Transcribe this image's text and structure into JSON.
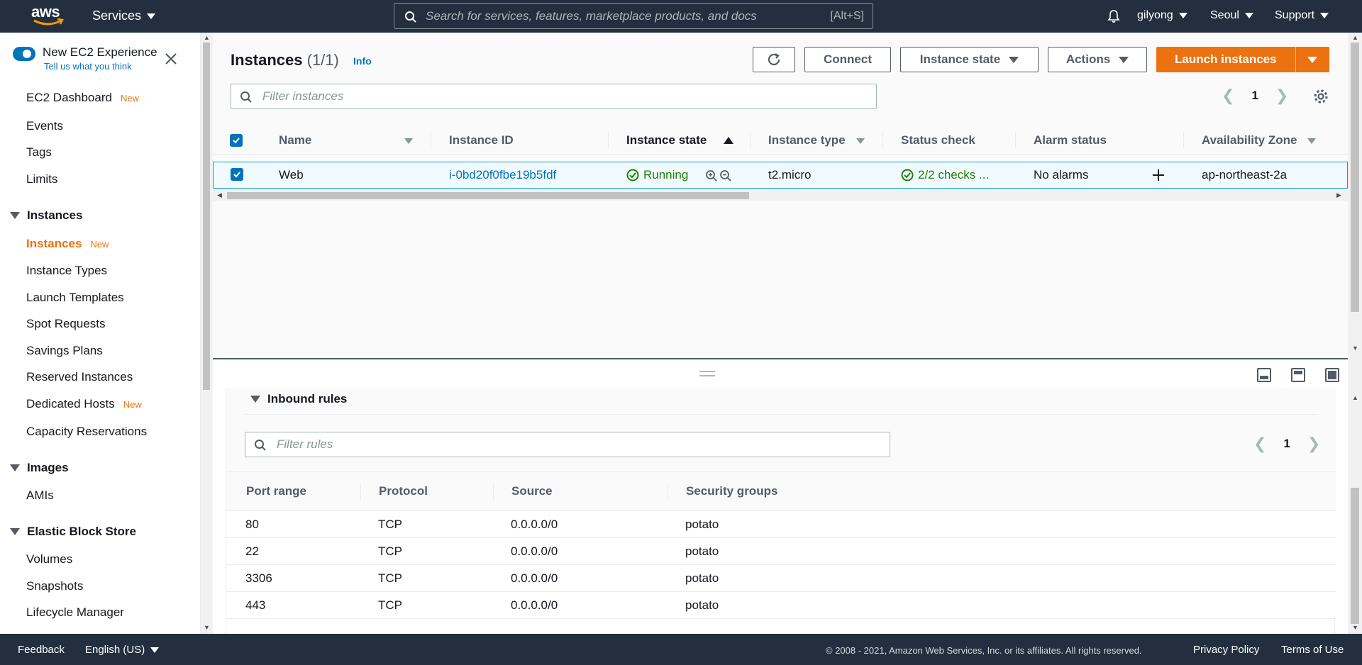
{
  "topnav": {
    "logo": "aws",
    "services": "Services",
    "search_placeholder": "Search for services, features, marketplace products, and docs",
    "search_shortcut": "[Alt+S]",
    "user": "gilyong",
    "region": "Seoul",
    "support": "Support"
  },
  "sidebar": {
    "new_experience": "New EC2 Experience",
    "tell_us": "Tell us what you think",
    "items": [
      {
        "label": "EC2 Dashboard",
        "badge": "New"
      },
      {
        "label": "Events"
      },
      {
        "label": "Tags"
      },
      {
        "label": "Limits"
      }
    ],
    "sections": {
      "instances": {
        "title": "Instances",
        "items": [
          {
            "label": "Instances",
            "badge": "New"
          },
          {
            "label": "Instance Types"
          },
          {
            "label": "Launch Templates"
          },
          {
            "label": "Spot Requests"
          },
          {
            "label": "Savings Plans"
          },
          {
            "label": "Reserved Instances"
          },
          {
            "label": "Dedicated Hosts",
            "badge": "New"
          },
          {
            "label": "Capacity Reservations"
          }
        ]
      },
      "images": {
        "title": "Images",
        "items": [
          {
            "label": "AMIs"
          }
        ]
      },
      "ebs": {
        "title": "Elastic Block Store",
        "items": [
          {
            "label": "Volumes"
          },
          {
            "label": "Snapshots"
          },
          {
            "label": "Lifecycle Manager"
          }
        ]
      }
    }
  },
  "instances": {
    "title": "Instances",
    "count": "(1/1)",
    "info": "Info",
    "buttons": {
      "connect": "Connect",
      "instance_state": "Instance state",
      "actions": "Actions",
      "launch": "Launch instances"
    },
    "filter_placeholder": "Filter instances",
    "page": "1",
    "columns": [
      "Name",
      "Instance ID",
      "Instance state",
      "Instance type",
      "Status check",
      "Alarm status",
      "Availability Zone"
    ],
    "rows": [
      {
        "name": "Web",
        "id": "i-0bd20f0fbe19b5fdf",
        "state": "Running",
        "type": "t2.micro",
        "status": "2/2 checks ...",
        "alarm": "No alarms",
        "az": "ap-northeast-2a"
      }
    ]
  },
  "inbound": {
    "title": "Inbound rules",
    "filter_placeholder": "Filter rules",
    "page": "1",
    "columns": [
      "Port range",
      "Protocol",
      "Source",
      "Security groups"
    ],
    "rows": [
      {
        "port": "80",
        "protocol": "TCP",
        "source": "0.0.0.0/0",
        "sg": "potato"
      },
      {
        "port": "22",
        "protocol": "TCP",
        "source": "0.0.0.0/0",
        "sg": "potato"
      },
      {
        "port": "3306",
        "protocol": "TCP",
        "source": "0.0.0.0/0",
        "sg": "potato"
      },
      {
        "port": "443",
        "protocol": "TCP",
        "source": "0.0.0.0/0",
        "sg": "potato"
      }
    ]
  },
  "footer": {
    "feedback": "Feedback",
    "language": "English (US)",
    "copyright": "© 2008 - 2021, Amazon Web Services, Inc. or its affiliates. All rights reserved.",
    "privacy": "Privacy Policy",
    "terms": "Terms of Use"
  },
  "colors": {
    "nav": "#232f3e",
    "accent": "#ec7211",
    "link": "#0073bb",
    "success": "#1d8102"
  }
}
